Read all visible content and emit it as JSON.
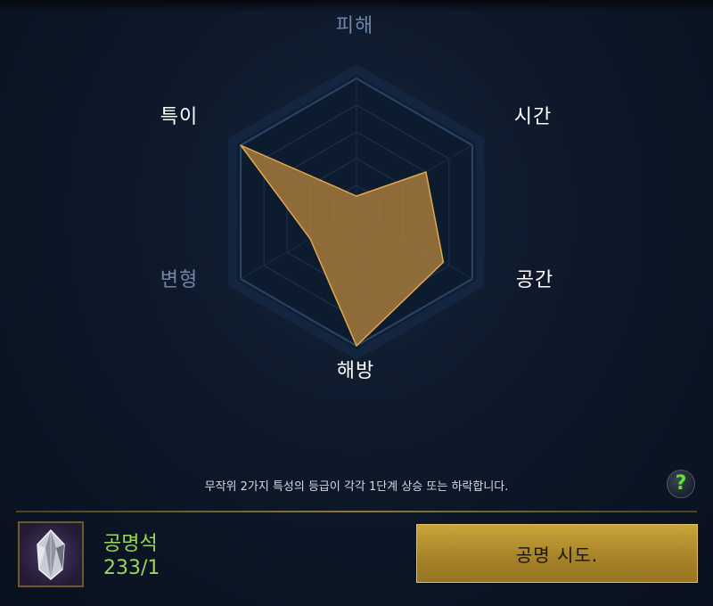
{
  "radar": {
    "axes": [
      {
        "label": "피해",
        "value": 0.0,
        "active": false
      },
      {
        "label": "시간",
        "value": 0.6,
        "active": true
      },
      {
        "label": "공간",
        "value": 0.75,
        "active": true
      },
      {
        "label": "해방",
        "value": 1.0,
        "active": true
      },
      {
        "label": "변형",
        "value": 0.4,
        "active": false
      },
      {
        "label": "특이",
        "value": 1.0,
        "active": true
      }
    ],
    "levels": 5,
    "fill_color": "#b5813e",
    "stroke_color": "#e0a84e"
  },
  "description": "무작위 2가지 특성의 등급이 각각 1단계 상승 또는 하락합니다.",
  "help_button": {
    "label": "?"
  },
  "item": {
    "name": "공명석",
    "count": "233/1",
    "icon": "crystal-stone-icon"
  },
  "action_button": {
    "label": "공명 시도."
  }
}
